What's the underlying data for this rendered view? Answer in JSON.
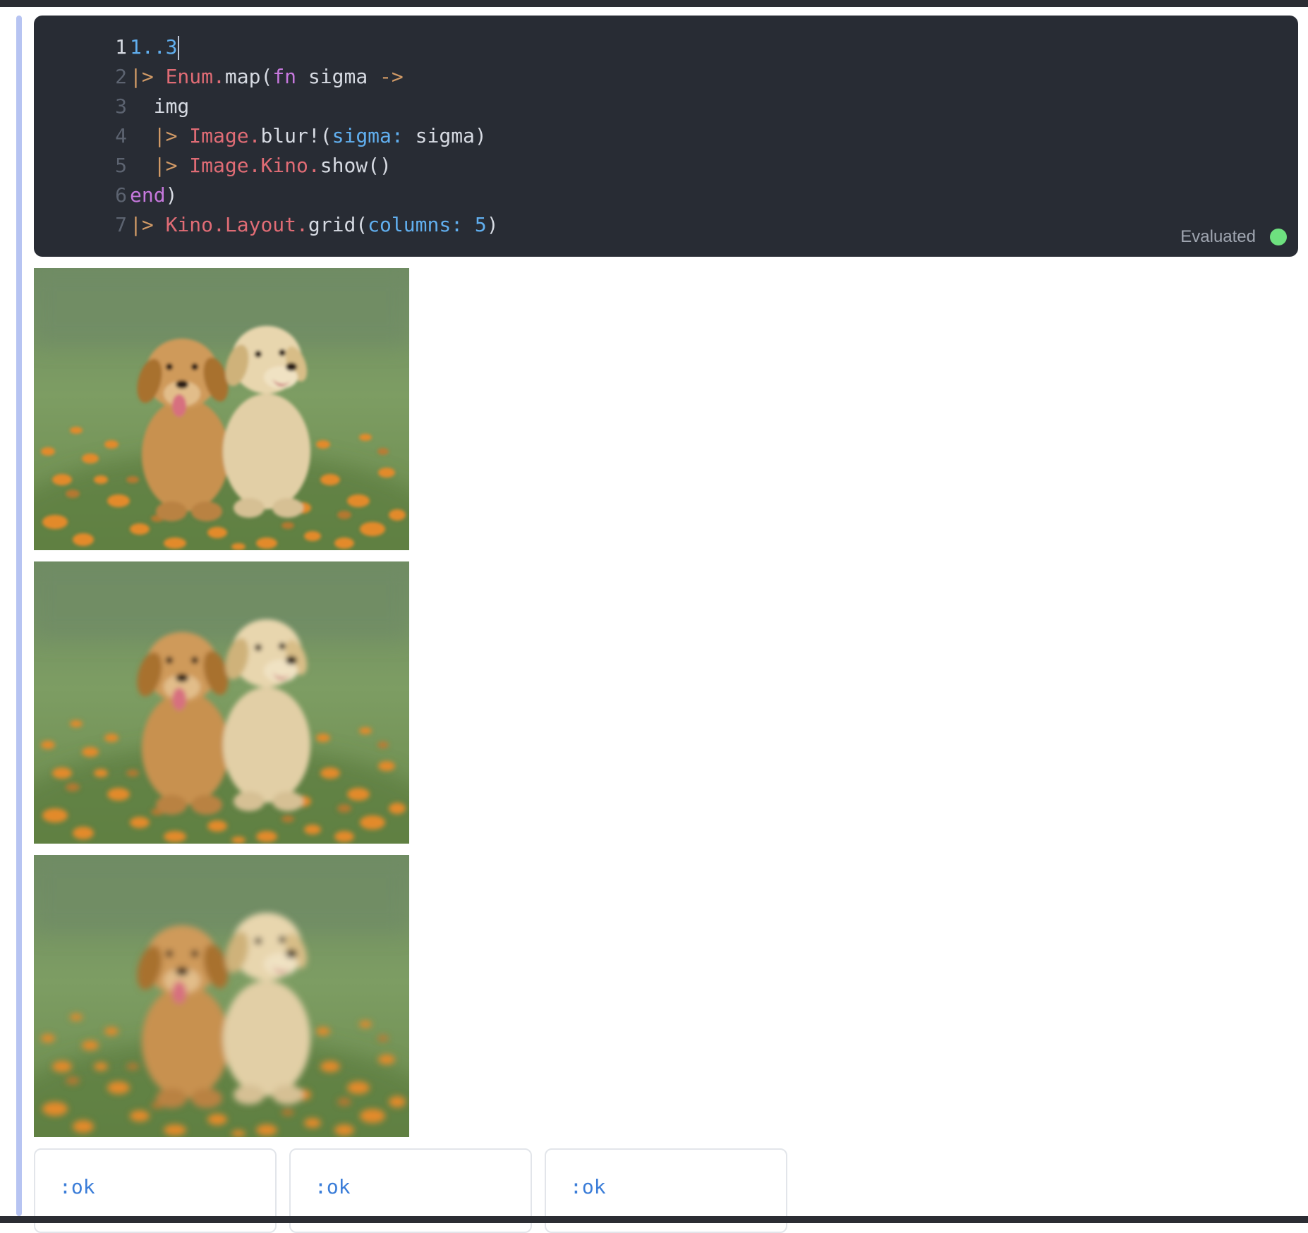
{
  "code_cell": {
    "lines": [
      {
        "number": "1",
        "active": true,
        "tokens": [
          {
            "t": "1..3",
            "c": "c-num"
          }
        ]
      },
      {
        "number": "2",
        "tokens": [
          {
            "t": "|>",
            "c": "c-op"
          },
          {
            "t": " ",
            "c": "c-txt"
          },
          {
            "t": "Enum.",
            "c": "c-mod"
          },
          {
            "t": "map(",
            "c": "c-txt"
          },
          {
            "t": "fn",
            "c": "c-key"
          },
          {
            "t": " sigma ",
            "c": "c-txt"
          },
          {
            "t": "->",
            "c": "c-op"
          }
        ]
      },
      {
        "number": "3",
        "tokens": [
          {
            "t": "  img",
            "c": "c-txt"
          }
        ]
      },
      {
        "number": "4",
        "tokens": [
          {
            "t": "  ",
            "c": "c-txt"
          },
          {
            "t": "|>",
            "c": "c-op"
          },
          {
            "t": " ",
            "c": "c-txt"
          },
          {
            "t": "Image.",
            "c": "c-mod"
          },
          {
            "t": "blur!(",
            "c": "c-txt"
          },
          {
            "t": "sigma:",
            "c": "c-atom"
          },
          {
            "t": " sigma)",
            "c": "c-txt"
          }
        ]
      },
      {
        "number": "5",
        "tokens": [
          {
            "t": "  ",
            "c": "c-txt"
          },
          {
            "t": "|>",
            "c": "c-op"
          },
          {
            "t": " ",
            "c": "c-txt"
          },
          {
            "t": "Image.Kino.",
            "c": "c-mod"
          },
          {
            "t": "show()",
            "c": "c-txt"
          }
        ]
      },
      {
        "number": "6",
        "tokens": [
          {
            "t": "end",
            "c": "c-key"
          },
          {
            "t": ")",
            "c": "c-txt"
          }
        ]
      },
      {
        "number": "7",
        "tokens": [
          {
            "t": "|>",
            "c": "c-op"
          },
          {
            "t": " ",
            "c": "c-txt"
          },
          {
            "t": "Kino.Layout.",
            "c": "c-mod"
          },
          {
            "t": "grid(",
            "c": "c-txt"
          },
          {
            "t": "columns:",
            "c": "c-atom"
          },
          {
            "t": " ",
            "c": "c-txt"
          },
          {
            "t": "5",
            "c": "c-num"
          },
          {
            "t": ")",
            "c": "c-txt"
          }
        ]
      }
    ],
    "status_label": "Evaluated",
    "status_color": "#6ee07f"
  },
  "outputs": {
    "images": [
      {
        "blur_sigma": 1
      },
      {
        "blur_sigma": 2
      },
      {
        "blur_sigma": 3
      }
    ],
    "results": [
      {
        "value": ":ok"
      },
      {
        "value": ":ok"
      },
      {
        "value": ":ok"
      }
    ]
  },
  "colors": {
    "editor_bg": "#282c34",
    "focus_bar": "#b7c4f2",
    "ok_text": "#3b7dd8"
  }
}
